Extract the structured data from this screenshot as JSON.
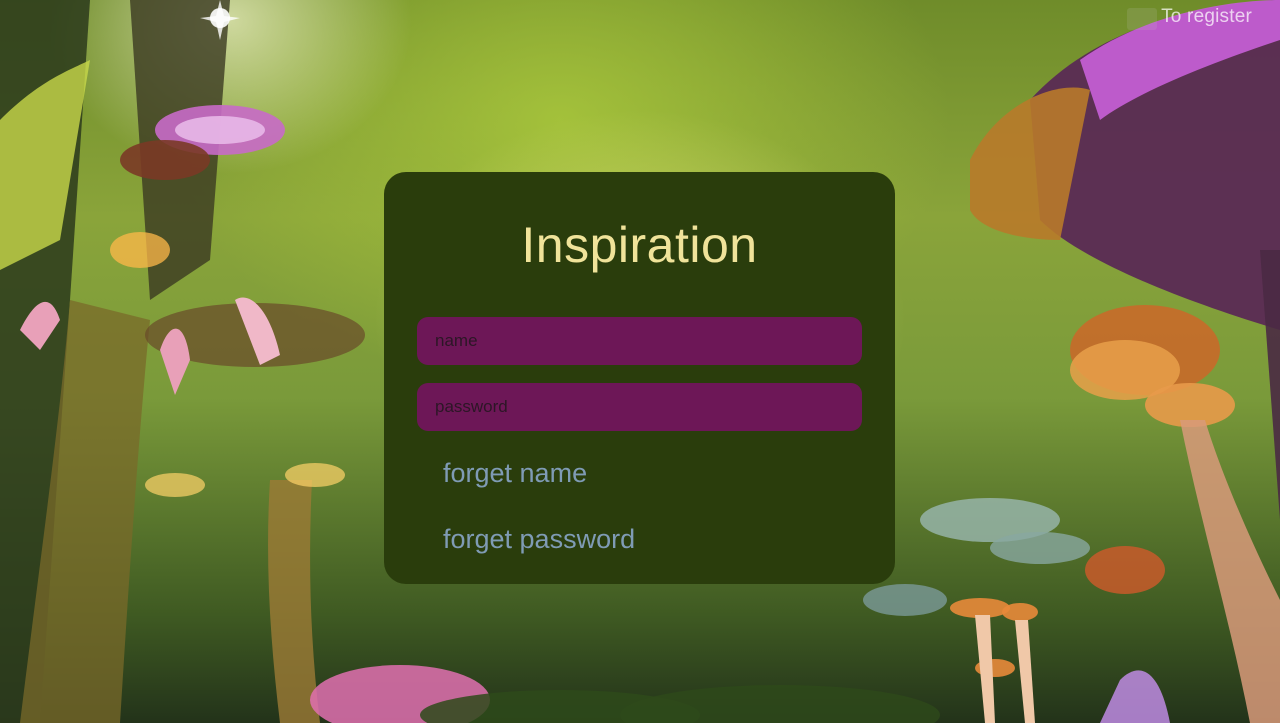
{
  "header": {
    "register_label": "To register"
  },
  "login_card": {
    "title": "Inspiration",
    "name_placeholder": "name",
    "password_placeholder": "password",
    "forget_name_label": "forget name",
    "forget_password_label": "forget password"
  },
  "colors": {
    "card_background": "#2a3d0c",
    "title_color": "#f0e39a",
    "input_background": "#6d1757",
    "link_color": "#7f9bb5"
  }
}
